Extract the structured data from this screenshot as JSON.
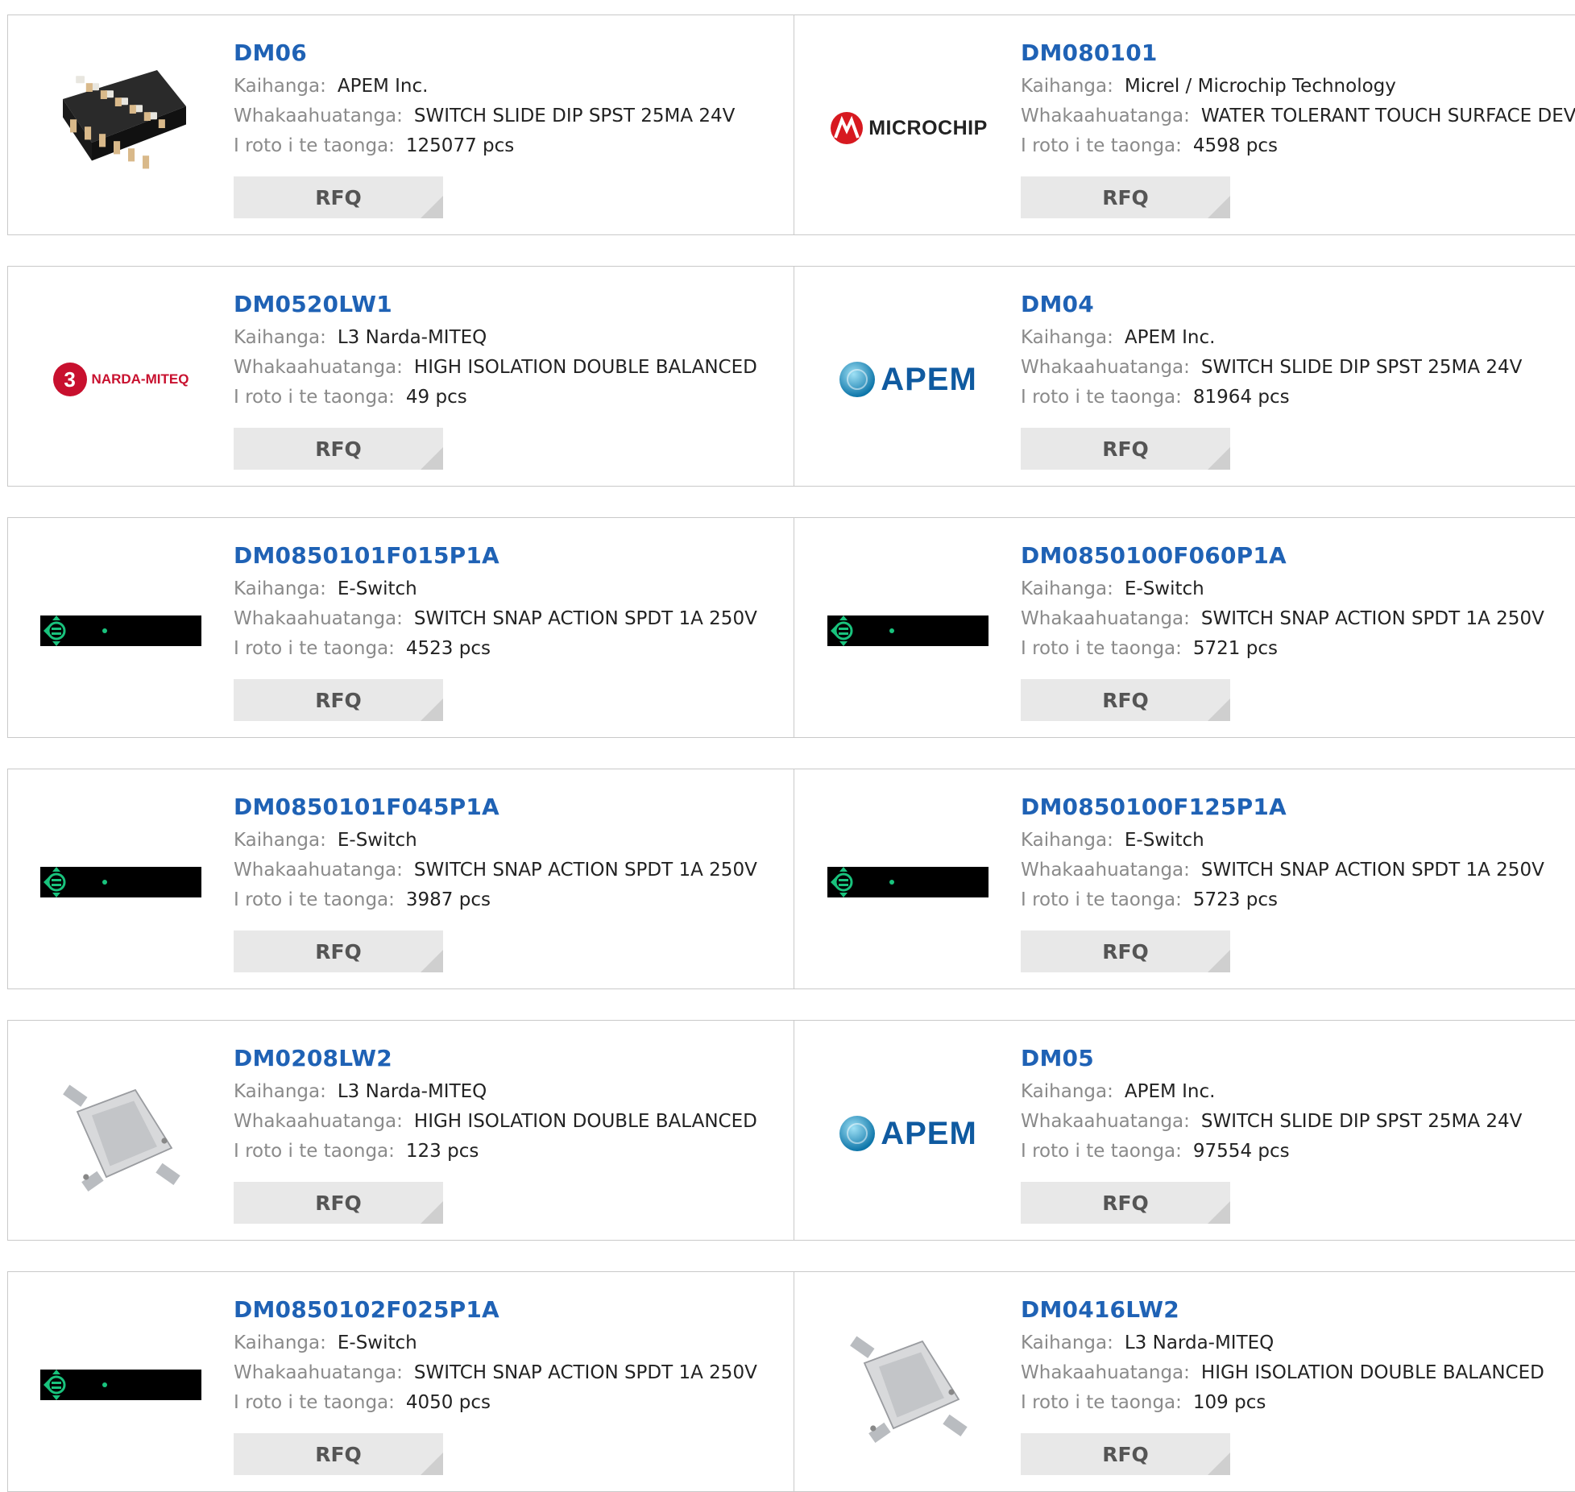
{
  "labels": {
    "manufacturer": "Kaihanga:",
    "description": "Whakaahuatanga:",
    "stock": "I roto i te taonga:",
    "rfq": "RFQ"
  },
  "logos": {
    "microchip": "MICROCHIP",
    "narda": "NARDA-MITEQ",
    "narda_mark": "3",
    "apem": "APEM"
  },
  "products": [
    {
      "name": "DM06",
      "manufacturer": "APEM Inc.",
      "description": "SWITCH SLIDE DIP SPST 25MA 24V",
      "stock": "125077 pcs",
      "image": "dip-switch-photo"
    },
    {
      "name": "DM080101",
      "manufacturer": "Micrel / Microchip Technology",
      "description": "WATER TOLERANT TOUCH SURFACE DEV",
      "stock": "4598 pcs",
      "image": "microchip-logo"
    },
    {
      "name": "DM0520LW1",
      "manufacturer": "L3 Narda-MITEQ",
      "description": "HIGH ISOLATION DOUBLE BALANCED",
      "stock": "49 pcs",
      "image": "narda-miteq-logo"
    },
    {
      "name": "DM04",
      "manufacturer": "APEM Inc.",
      "description": "SWITCH SLIDE DIP SPST 25MA 24V",
      "stock": "81964 pcs",
      "image": "apem-logo"
    },
    {
      "name": "DM0850101F015P1A",
      "manufacturer": "E-Switch",
      "description": "SWITCH SNAP ACTION SPDT 1A 250V",
      "stock": "4523 pcs",
      "image": "e-switch-logo"
    },
    {
      "name": "DM0850100F060P1A",
      "manufacturer": "E-Switch",
      "description": "SWITCH SNAP ACTION SPDT 1A 250V",
      "stock": "5721 pcs",
      "image": "e-switch-logo"
    },
    {
      "name": "DM0850101F045P1A",
      "manufacturer": "E-Switch",
      "description": "SWITCH SNAP ACTION SPDT 1A 250V",
      "stock": "3987 pcs",
      "image": "e-switch-logo"
    },
    {
      "name": "DM0850100F125P1A",
      "manufacturer": "E-Switch",
      "description": "SWITCH SNAP ACTION SPDT 1A 250V",
      "stock": "5723 pcs",
      "image": "e-switch-logo"
    },
    {
      "name": "DM0208LW2",
      "manufacturer": "L3 Narda-MITEQ",
      "description": "HIGH ISOLATION DOUBLE BALANCED",
      "stock": "123 pcs",
      "image": "mixer-photo"
    },
    {
      "name": "DM05",
      "manufacturer": "APEM Inc.",
      "description": "SWITCH SLIDE DIP SPST 25MA 24V",
      "stock": "97554 pcs",
      "image": "apem-logo"
    },
    {
      "name": "DM0850102F025P1A",
      "manufacturer": "E-Switch",
      "description": "SWITCH SNAP ACTION SPDT 1A 250V",
      "stock": "4050 pcs",
      "image": "e-switch-logo"
    },
    {
      "name": "DM0416LW2",
      "manufacturer": "L3 Narda-MITEQ",
      "description": "HIGH ISOLATION DOUBLE BALANCED",
      "stock": "109 pcs",
      "image": "mixer-photo"
    }
  ]
}
